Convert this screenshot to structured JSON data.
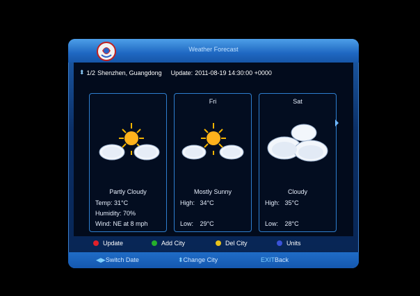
{
  "window": {
    "title": "Weather Forecast"
  },
  "location": {
    "index": "1/2",
    "city": "Shenzhen, Guangdong",
    "update_label": "Update:",
    "update_time": "2011-08-19 14:30:00 +0000"
  },
  "cards": [
    {
      "day": "",
      "condition": "Partly Cloudy",
      "icon": "partly-cloudy-icon",
      "line1_label": "Temp:",
      "line1_value": "31°C",
      "line2_label": "Humidity:",
      "line2_value": "70%",
      "line3_label": "Wind:",
      "line3_value": "NE at 8 mph"
    },
    {
      "day": "Fri",
      "condition": "Mostly Sunny",
      "icon": "mostly-sunny-icon",
      "line1_label": "High:",
      "line1_value": "34°C",
      "line2_label": "Low:",
      "line2_value": "29°C"
    },
    {
      "day": "Sat",
      "condition": "Cloudy",
      "icon": "cloudy-icon",
      "line1_label": "High:",
      "line1_value": "35°C",
      "line2_label": "Low:",
      "line2_value": "28°C"
    }
  ],
  "color_buttons": [
    {
      "label": "Update",
      "color": "#e0202a"
    },
    {
      "label": "Add City",
      "color": "#25b02c"
    },
    {
      "label": "Del City",
      "color": "#e8c21a"
    },
    {
      "label": "Units",
      "color": "#3a52d8"
    }
  ],
  "nav_hints": {
    "switch_date": "Switch Date",
    "change_city": "Change City",
    "exit_key": "EXIT",
    "exit_label": "Back"
  }
}
